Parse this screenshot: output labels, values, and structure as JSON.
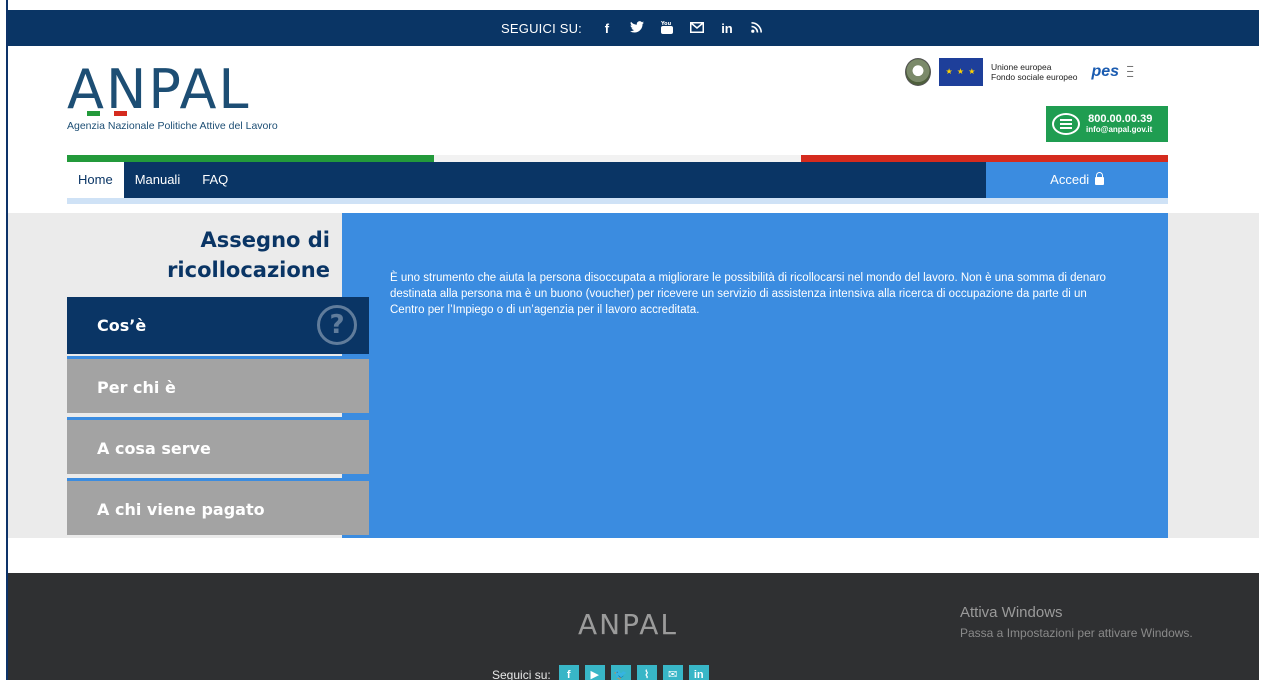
{
  "topbar": {
    "label": "SEGUICI SU:",
    "socials": [
      {
        "icon": "facebook-icon",
        "glyph": "f"
      },
      {
        "icon": "twitter-icon",
        "glyph": "🐦"
      },
      {
        "icon": "youtube-icon",
        "glyph": "▶"
      },
      {
        "icon": "mail-icon",
        "glyph": "✉"
      },
      {
        "icon": "linkedin-icon",
        "glyph": "in"
      },
      {
        "icon": "rss-icon",
        "glyph": "⌇"
      }
    ]
  },
  "header": {
    "logo_text": "ANPAL",
    "logo_subtitle": "Agenzia Nazionale Politiche Attive del Lavoro",
    "eu_text_line1": "Unione europea",
    "eu_text_line2": "Fondo sociale europeo",
    "pes_text": "pes",
    "contact_phone": "800.00.00.39",
    "contact_email": "info@anpal.gov.it"
  },
  "colors": {
    "brand_dark": "#0a3565",
    "accent_blue": "#3b8ce0",
    "italy_green": "#239a3b",
    "italy_white": "#f2f2f2",
    "italy_red": "#d52b1e",
    "footer_bg": "#2f3032"
  },
  "nav": {
    "items": [
      "Home",
      "Manuali",
      "FAQ"
    ],
    "login_label": "Accedi"
  },
  "sidebar": {
    "title": "Assegno di ricollocazione",
    "items": [
      "Cos’è",
      "Per chi è",
      "A cosa serve",
      "A chi viene pagato"
    ],
    "active_index": 0
  },
  "main": {
    "description": "È uno strumento che aiuta la persona disoccupata a migliorare le possibilità di ricollocarsi nel mondo del lavoro. Non è una somma di denaro destinata alla persona ma è un buono (voucher) per ricevere un servizio di assistenza intensiva alla ricerca di occupazione da parte di un Centro per l’Impiego o di un’agenzia per il lavoro accreditata."
  },
  "footer": {
    "logo_text": "ANPAL",
    "follow_label": "Seguici su:",
    "socials": [
      "f",
      "▶",
      "🐦",
      "⌇",
      "✉",
      "in"
    ]
  },
  "windows_watermark": {
    "title": "Attiva Windows",
    "subtitle": "Passa a Impostazioni per attivare Windows."
  }
}
